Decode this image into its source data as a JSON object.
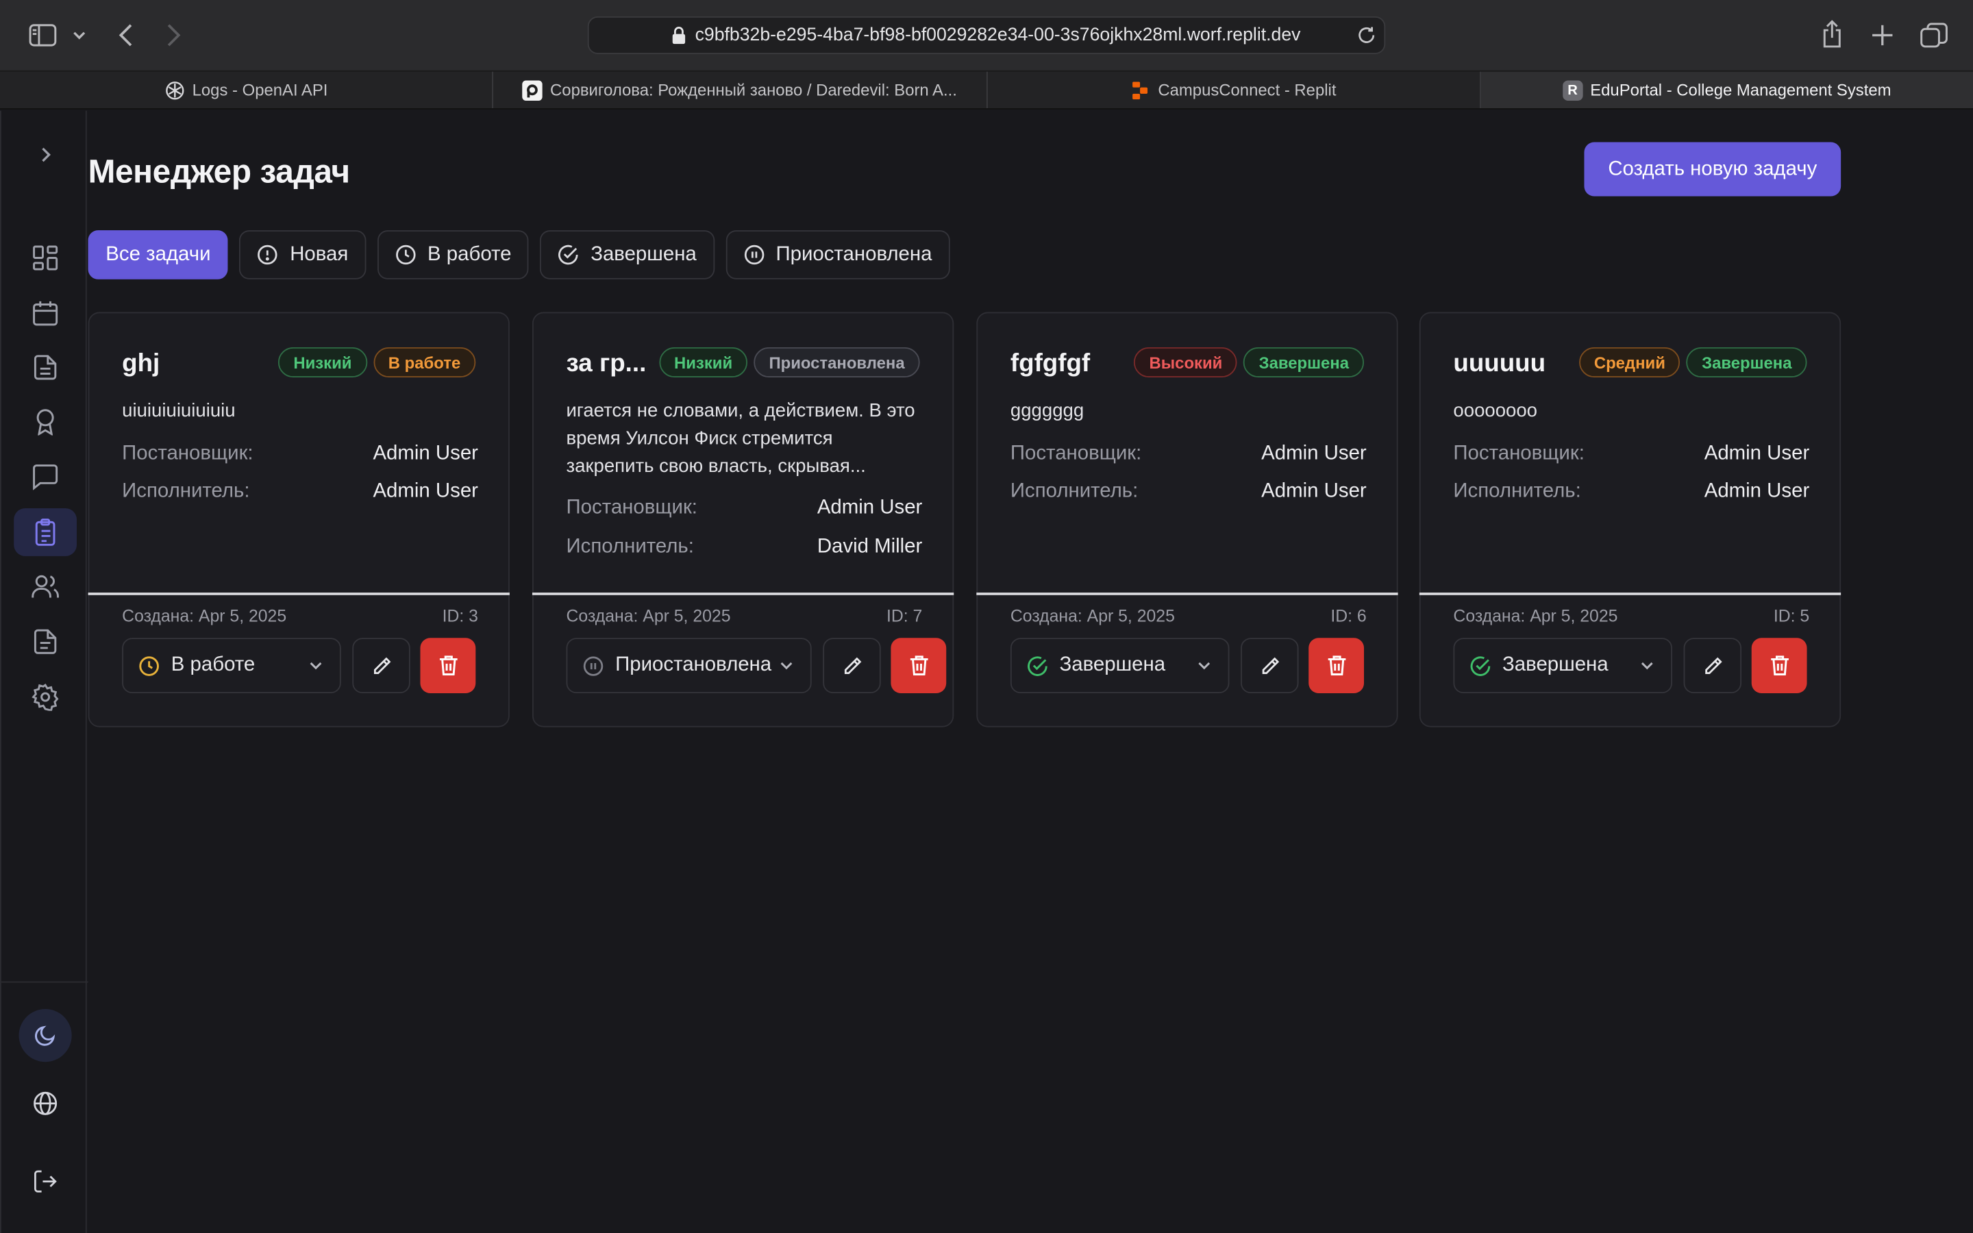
{
  "browser": {
    "url": "c9bfb32b-e295-4ba7-bf98-bf0029282e34-00-3s76ojkhx28ml.worf.replit.dev",
    "tabs": [
      {
        "title": "Logs - OpenAI API",
        "icon": "openai-icon",
        "active": false
      },
      {
        "title": "Сорвиголова: Рожденный заново / Daredevil: Born A...",
        "icon": "media-site-icon",
        "active": false
      },
      {
        "title": "CampusConnect - Replit",
        "icon": "replit-icon",
        "active": false
      },
      {
        "title": "EduPortal - College Management System",
        "icon": "eduportal-icon",
        "active": true
      }
    ]
  },
  "page": {
    "title": "Менеджер задач",
    "create_button": "Создать новую задачу"
  },
  "filters": [
    {
      "label": "Все задачи",
      "active": true,
      "icon": ""
    },
    {
      "label": "Новая",
      "active": false,
      "icon": "alert-circle-icon"
    },
    {
      "label": "В работе",
      "active": false,
      "icon": "clock-icon"
    },
    {
      "label": "Завершена",
      "active": false,
      "icon": "check-circle-icon"
    },
    {
      "label": "Приостановлена",
      "active": false,
      "icon": "pause-circle-icon"
    }
  ],
  "labels": {
    "assigner": "Постановщик:",
    "assignee": "Исполнитель:"
  },
  "tasks": [
    {
      "title": "ghj",
      "priority": "Низкий",
      "status_badge": "В работе",
      "description": "uiuiuiuiuiuiuiu",
      "assigner": "Admin User",
      "assignee": "Admin User",
      "created": "Создана: Apr 5, 2025",
      "id": "ID: 3",
      "status_value": "В работе"
    },
    {
      "title": "за гр...",
      "priority": "Низкий",
      "status_badge": "Приостановлена",
      "description": "игается не словами, а действием. В это время Уилсон Фиск стремится закрепить свою власть, скрывая...",
      "assigner": "Admin User",
      "assignee": "David Miller",
      "created": "Создана: Apr 5, 2025",
      "id": "ID: 7",
      "status_value": "Приостановлена"
    },
    {
      "title": "fgfgfgf",
      "priority": "Высокий",
      "status_badge": "Завершена",
      "description": "ggggggg",
      "assigner": "Admin User",
      "assignee": "Admin User",
      "created": "Создана: Apr 5, 2025",
      "id": "ID: 6",
      "status_value": "Завершена"
    },
    {
      "title": "uuuuuu",
      "priority": "Средний",
      "status_badge": "Завершена",
      "description": "oooooooo",
      "assigner": "Admin User",
      "assignee": "Admin User",
      "created": "Создана: Apr 5, 2025",
      "id": "ID: 5",
      "status_value": "Завершена"
    }
  ],
  "colors": {
    "accent": "#6559d9",
    "delete": "#d8352f",
    "background": "#18181c"
  }
}
